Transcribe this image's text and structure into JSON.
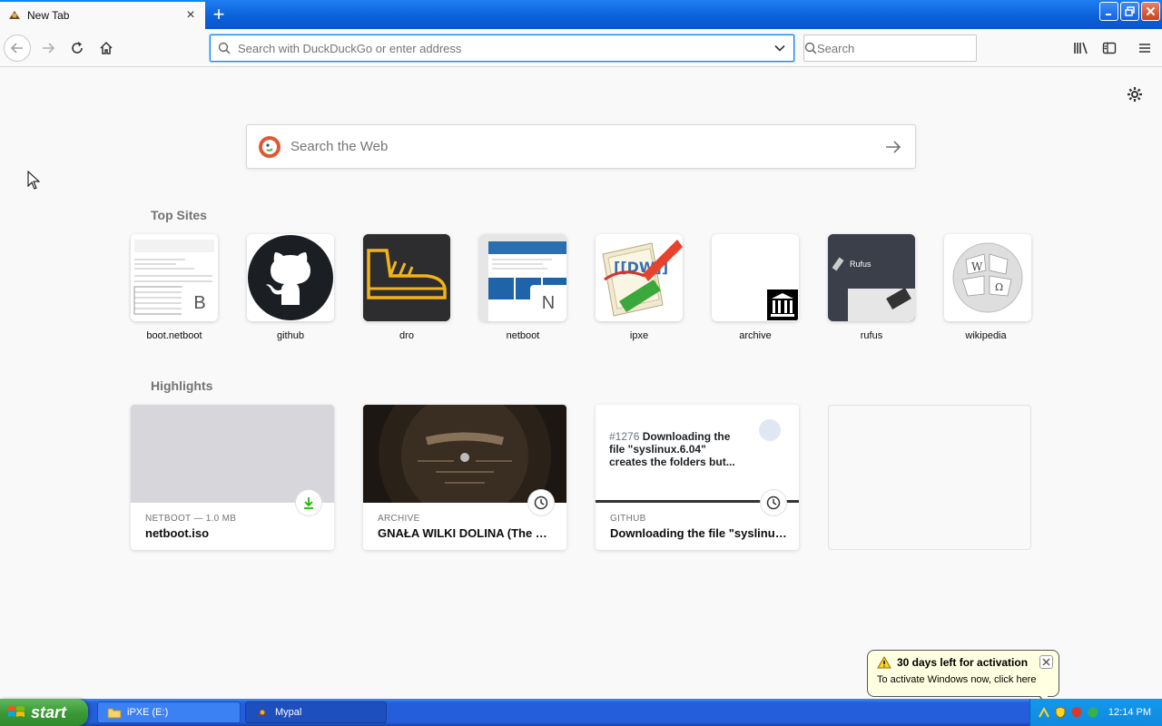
{
  "tab": {
    "title": "New Tab",
    "close": "×",
    "new_tab": "+"
  },
  "urlbar": {
    "placeholder": "Search with DuckDuckGo or enter address"
  },
  "searchbar": {
    "placeholder": "Search"
  },
  "web_search": {
    "placeholder": "Search the Web"
  },
  "sections": {
    "top_sites": "Top Sites",
    "highlights": "Highlights"
  },
  "top_sites": [
    {
      "label": "boot.netboot",
      "badge": "B"
    },
    {
      "label": "github"
    },
    {
      "label": "dro"
    },
    {
      "label": "netboot",
      "badge": "N"
    },
    {
      "label": "ipxe"
    },
    {
      "label": "archive"
    },
    {
      "label": "rufus"
    },
    {
      "label": "wikipedia"
    }
  ],
  "highlights": [
    {
      "source": "NETBOOT — 1.0 MB",
      "title": "netboot.iso"
    },
    {
      "source": "ARCHIVE",
      "title": "GNAŁA WILKI DOLINA (The Wolf..."
    },
    {
      "source": "GITHUB",
      "title": "Downloading the file \"syslinux.6...",
      "preview_issue": "#1276",
      "preview_title": "Downloading the file \"syslinux.6.04\" creates the folders but..."
    }
  ],
  "balloon": {
    "title": "30 days left for activation",
    "message": "To activate Windows now, click here"
  },
  "taskbar": {
    "start": "start",
    "items": [
      {
        "label": "iPXE (E:)"
      },
      {
        "label": "Mypal"
      }
    ],
    "clock": "12:14 PM"
  },
  "colors": {
    "accent": "#0a84ff",
    "taskbar": "#245edb",
    "start_green": "#3c9a37"
  }
}
